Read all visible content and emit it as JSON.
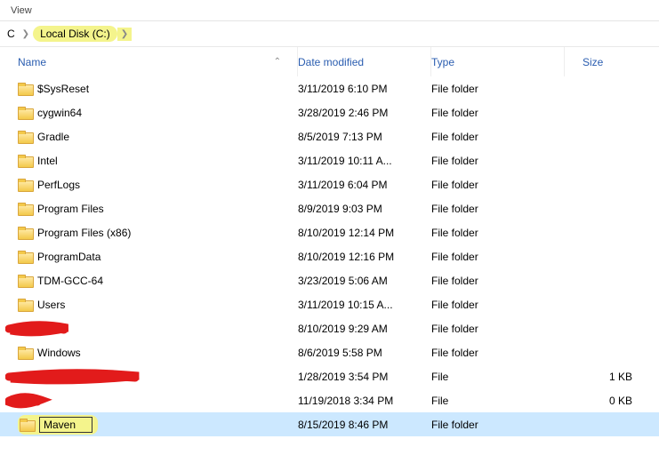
{
  "tab": {
    "view": "View"
  },
  "breadcrumb": {
    "root": "C",
    "current": "Local Disk (C:)"
  },
  "headers": {
    "name": "Name",
    "date": "Date modified",
    "type": "Type",
    "size": "Size"
  },
  "rows": [
    {
      "name": "$SysReset",
      "date": "3/11/2019 6:10 PM",
      "type": "File folder",
      "size": "",
      "icon": "folder"
    },
    {
      "name": "cygwin64",
      "date": "3/28/2019 2:46 PM",
      "type": "File folder",
      "size": "",
      "icon": "folder"
    },
    {
      "name": "Gradle",
      "date": "8/5/2019 7:13 PM",
      "type": "File folder",
      "size": "",
      "icon": "folder"
    },
    {
      "name": "Intel",
      "date": "3/11/2019 10:11 A...",
      "type": "File folder",
      "size": "",
      "icon": "folder"
    },
    {
      "name": "PerfLogs",
      "date": "3/11/2019 6:04 PM",
      "type": "File folder",
      "size": "",
      "icon": "folder"
    },
    {
      "name": "Program Files",
      "date": "8/9/2019 9:03 PM",
      "type": "File folder",
      "size": "",
      "icon": "folder"
    },
    {
      "name": "Program Files (x86)",
      "date": "8/10/2019 12:14 PM",
      "type": "File folder",
      "size": "",
      "icon": "folder"
    },
    {
      "name": "ProgramData",
      "date": "8/10/2019 12:16 PM",
      "type": "File folder",
      "size": "",
      "icon": "folder"
    },
    {
      "name": "TDM-GCC-64",
      "date": "3/23/2019 5:06 AM",
      "type": "File folder",
      "size": "",
      "icon": "folder"
    },
    {
      "name": "Users",
      "date": "3/11/2019 10:15 A...",
      "type": "File folder",
      "size": "",
      "icon": "folder"
    },
    {
      "name": "",
      "date": "8/10/2019 9:29 AM",
      "type": "File folder",
      "size": "",
      "icon": "redact"
    },
    {
      "name": "Windows",
      "date": "8/6/2019 5:58 PM",
      "type": "File folder",
      "size": "",
      "icon": "folder"
    },
    {
      "name": "",
      "date": "1/28/2019 3:54 PM",
      "type": "File",
      "size": "1 KB",
      "icon": "redact-long"
    },
    {
      "name": "",
      "date": "11/19/2018 3:34 PM",
      "type": "File",
      "size": "0 KB",
      "icon": "redact-short"
    },
    {
      "name": "Maven",
      "date": "8/15/2019 8:46 PM",
      "type": "File folder",
      "size": "",
      "icon": "folder",
      "rename": true,
      "selected": true
    }
  ]
}
